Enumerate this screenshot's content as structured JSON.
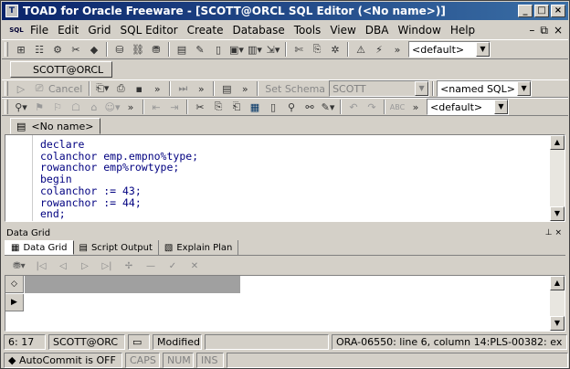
{
  "window": {
    "title": "TOAD for Oracle Freeware - [SCOTT@ORCL SQL Editor (<No name>)]",
    "icon_label": "T",
    "controls": [
      "_",
      "□",
      "×"
    ]
  },
  "menubar": {
    "lead_icon": "sql-editor-icon",
    "items": [
      "File",
      "Edit",
      "Grid",
      "SQL Editor",
      "Create",
      "Database",
      "Tools",
      "View",
      "DBA",
      "Window",
      "Help"
    ],
    "right_controls": [
      "–",
      "⧉",
      "×"
    ]
  },
  "toolbar1": {
    "combo_value": "<default>"
  },
  "session": {
    "label": "SCOTT@ORCL"
  },
  "toolbar2": {
    "cancel_label": "Cancel",
    "set_schema_label": "Set Schema",
    "schema_value": "SCOTT",
    "named_sql_value": "<named SQL>"
  },
  "toolbar3": {
    "combo_value": "<default>"
  },
  "editor": {
    "tab_label": "<No name>",
    "code": "declare\ncolanchor emp.empno%type;\nrowanchor emp%rowtype;\nbegin\ncolanchor := 43;\nrowanchor := 44;\nend;"
  },
  "data_grid": {
    "panel_title": "Data Grid",
    "tabs": [
      "Data Grid",
      "Script Output",
      "Explain Plan"
    ]
  },
  "status": {
    "position": "6: 17",
    "connection": "SCOTT@ORC",
    "modified": "Modified",
    "message": "ORA-06550: line 6, column 14:PLS-00382: ex",
    "autocommit": "AutoCommit is OFF",
    "caps": "CAPS",
    "num": "NUM",
    "ins": "INS"
  }
}
